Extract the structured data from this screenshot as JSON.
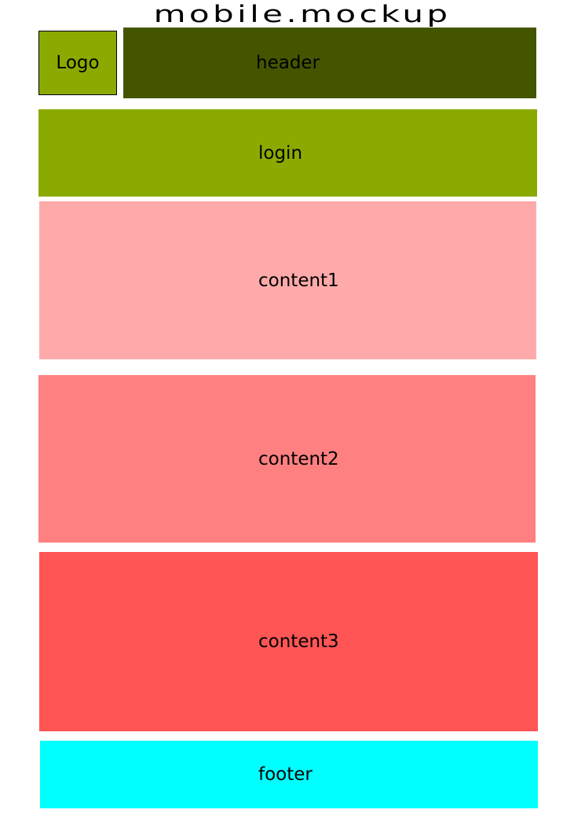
{
  "title": "mobile.mockup",
  "blocks": {
    "logo": {
      "label": "Logo",
      "color": "#8aaa00"
    },
    "header": {
      "label": "header",
      "color": "#445500"
    },
    "login": {
      "label": "login",
      "color": "#8aaa00"
    },
    "content1": {
      "label": "content1",
      "color": "#ffaaaa"
    },
    "content2": {
      "label": "content2",
      "color": "#ff8080"
    },
    "content3": {
      "label": "content3",
      "color": "#ff5555"
    },
    "footer": {
      "label": "footer",
      "color": "#00ffff"
    }
  }
}
